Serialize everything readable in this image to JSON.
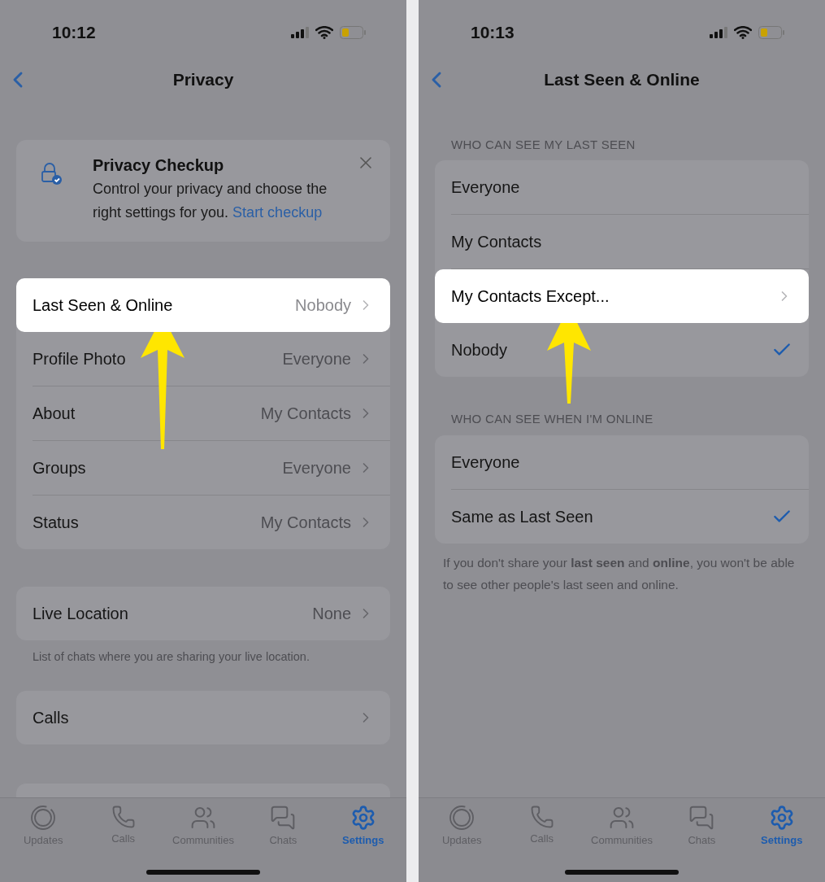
{
  "left_screen": {
    "status_bar": {
      "time": "10:12"
    },
    "nav": {
      "title": "Privacy"
    },
    "checkup_card": {
      "title": "Privacy Checkup",
      "text": "Control your privacy and choose the right settings for you.",
      "link": "Start checkup"
    },
    "groups": [
      {
        "rows": [
          {
            "label": "Last Seen & Online",
            "value": "Nobody",
            "highlighted": true
          },
          {
            "label": "Profile Photo",
            "value": "Everyone",
            "highlighted": false
          },
          {
            "label": "About",
            "value": "My Contacts",
            "highlighted": false
          },
          {
            "label": "Groups",
            "value": "Everyone",
            "highlighted": false
          },
          {
            "label": "Status",
            "value": "My Contacts",
            "highlighted": false
          }
        ]
      },
      {
        "rows": [
          {
            "label": "Live Location",
            "value": "None",
            "highlighted": false
          }
        ],
        "footer": "List of chats where you are sharing your live location."
      },
      {
        "rows": [
          {
            "label": "Calls",
            "highlighted": false
          }
        ]
      }
    ],
    "tabs": [
      {
        "label": "Updates",
        "selected": false
      },
      {
        "label": "Calls",
        "selected": false
      },
      {
        "label": "Communities",
        "selected": false
      },
      {
        "label": "Chats",
        "selected": false
      },
      {
        "label": "Settings",
        "selected": true
      }
    ]
  },
  "right_screen": {
    "status_bar": {
      "time": "10:13"
    },
    "nav": {
      "title": "Last Seen & Online"
    },
    "sections": [
      {
        "header": "WHO CAN SEE MY LAST SEEN",
        "options": [
          {
            "kind": "option",
            "label": "Everyone",
            "selected": false,
            "highlighted": false
          },
          {
            "kind": "option",
            "label": "My Contacts",
            "selected": false,
            "highlighted": false
          },
          {
            "kind": "link",
            "label": "My Contacts Except...",
            "highlighted": true
          },
          {
            "kind": "option",
            "label": "Nobody",
            "selected": true,
            "highlighted": false
          }
        ]
      },
      {
        "header": "WHO CAN SEE WHEN I'M ONLINE",
        "options": [
          {
            "kind": "option",
            "label": "Everyone",
            "selected": false,
            "highlighted": false
          },
          {
            "kind": "option",
            "label": "Same as Last Seen",
            "selected": true,
            "highlighted": false
          }
        ],
        "footer": "If you don't share your **last seen** and **online**, you won't be able to see other people's last seen and online."
      }
    ],
    "tabs": [
      {
        "label": "Updates",
        "selected": false
      },
      {
        "label": "Calls",
        "selected": false
      },
      {
        "label": "Communities",
        "selected": false
      },
      {
        "label": "Chats",
        "selected": false
      },
      {
        "label": "Settings",
        "selected": true
      }
    ]
  }
}
